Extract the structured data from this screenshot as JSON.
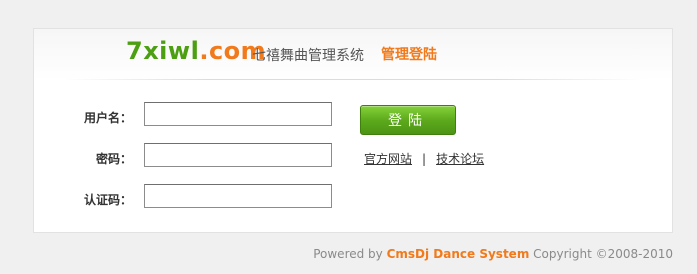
{
  "header": {
    "logo_main": "7xiwl",
    "logo_dot": ".",
    "logo_tld": "com",
    "subtitle": "七禧舞曲管理系统",
    "subtitle_accent": "管理登陆"
  },
  "form": {
    "username_label": "用户名：",
    "username_value": "",
    "password_label": "密码：",
    "password_value": "",
    "captcha_label": "认证码：",
    "captcha_value": "",
    "login_button": "登陆"
  },
  "links": {
    "official_site": "官方网站",
    "separator": "|",
    "tech_forum": "技术论坛"
  },
  "footer": {
    "powered_by": "Powered by ",
    "brand": "CmsDj Dance System",
    "copyright": " Copyright ©2008-2010"
  },
  "colors": {
    "brand_green": "#4b9f10",
    "accent_orange": "#f07a1c",
    "button_green": "#5daa1d"
  }
}
